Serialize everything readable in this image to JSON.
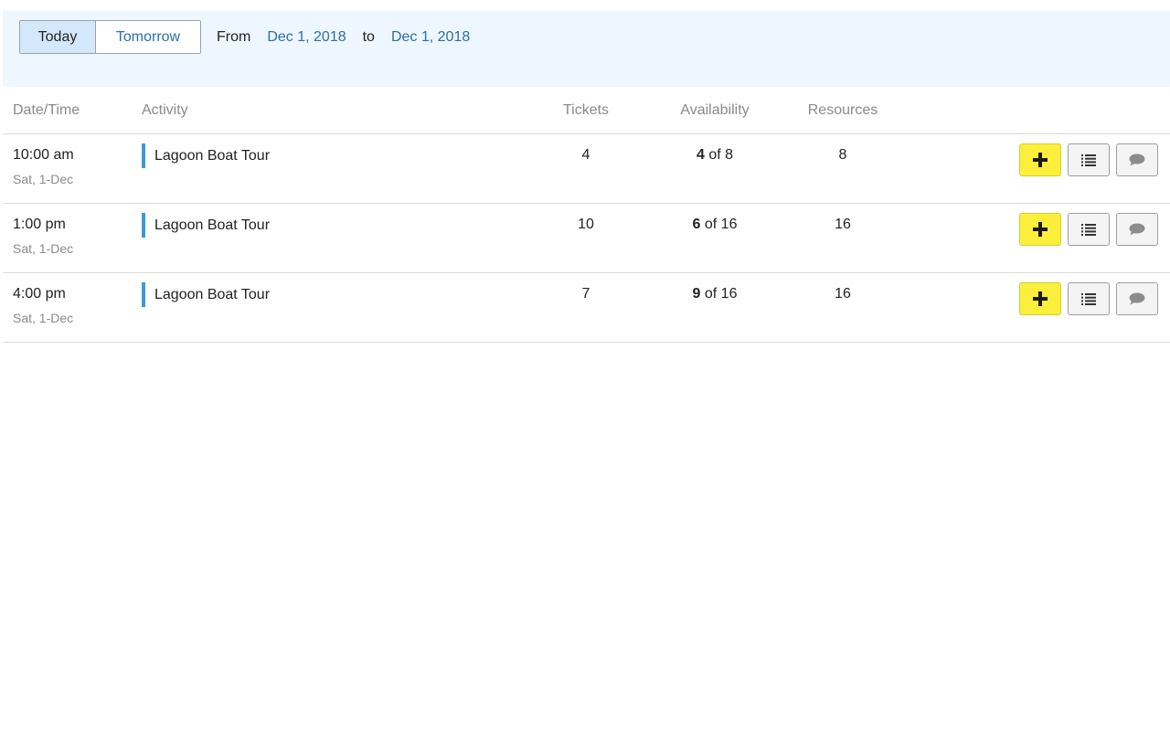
{
  "filter": {
    "today_label": "Today",
    "tomorrow_label": "Tomorrow",
    "from_label": "From",
    "from_date": "Dec 1, 2018",
    "to_label": "to",
    "to_date": "Dec 1, 2018"
  },
  "table": {
    "columns": {
      "datetime": "Date/Time",
      "activity": "Activity",
      "tickets": "Tickets",
      "availability": "Availability",
      "resources": "Resources"
    },
    "rows": [
      {
        "time": "10:00 am",
        "day": "Sat, 1-Dec",
        "activity": "Lagoon Boat Tour",
        "tickets": "4",
        "avail_num": "4",
        "avail_rest": " of 8",
        "resources": "8"
      },
      {
        "time": "1:00 pm",
        "day": "Sat, 1-Dec",
        "activity": "Lagoon Boat Tour",
        "tickets": "10",
        "avail_num": "6",
        "avail_rest": " of 16",
        "resources": "16"
      },
      {
        "time": "4:00 pm",
        "day": "Sat, 1-Dec",
        "activity": "Lagoon Boat Tour",
        "tickets": "7",
        "avail_num": "9",
        "avail_rest": " of 16",
        "resources": "16"
      }
    ]
  },
  "icons": {
    "add": "plus-icon",
    "manifest": "list-icon",
    "notes": "comment-icon"
  },
  "colors": {
    "accent_link": "#2a6fad",
    "activity_bar": "#3a9ad9",
    "add_button": "#fbef3b",
    "filter_bg": "#eef6ff"
  }
}
